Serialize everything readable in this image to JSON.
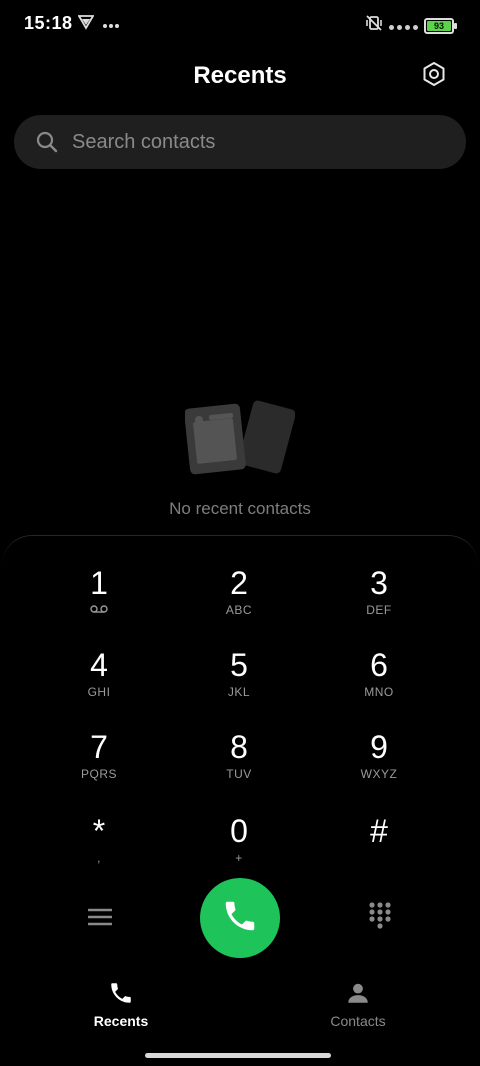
{
  "status_bar": {
    "time": "15:18",
    "battery_level": "93"
  },
  "header": {
    "title": "Recents"
  },
  "search": {
    "placeholder": "Search contacts"
  },
  "empty_state": {
    "text": "No recent contacts"
  },
  "dialpad": {
    "keys": [
      {
        "digit": "1",
        "letters": ""
      },
      {
        "digit": "2",
        "letters": "ABC"
      },
      {
        "digit": "3",
        "letters": "DEF"
      },
      {
        "digit": "4",
        "letters": "GHI"
      },
      {
        "digit": "5",
        "letters": "JKL"
      },
      {
        "digit": "6",
        "letters": "MNO"
      },
      {
        "digit": "7",
        "letters": "PQRS"
      },
      {
        "digit": "8",
        "letters": "TUV"
      },
      {
        "digit": "9",
        "letters": "WXYZ"
      },
      {
        "digit": "*",
        "letters": ","
      },
      {
        "digit": "0",
        "letters": "+"
      },
      {
        "digit": "#",
        "letters": ""
      }
    ]
  },
  "bottom_nav": {
    "recents_label": "Recents",
    "contacts_label": "Contacts"
  },
  "colors": {
    "call_button": "#1ec35a",
    "background": "#000000"
  }
}
